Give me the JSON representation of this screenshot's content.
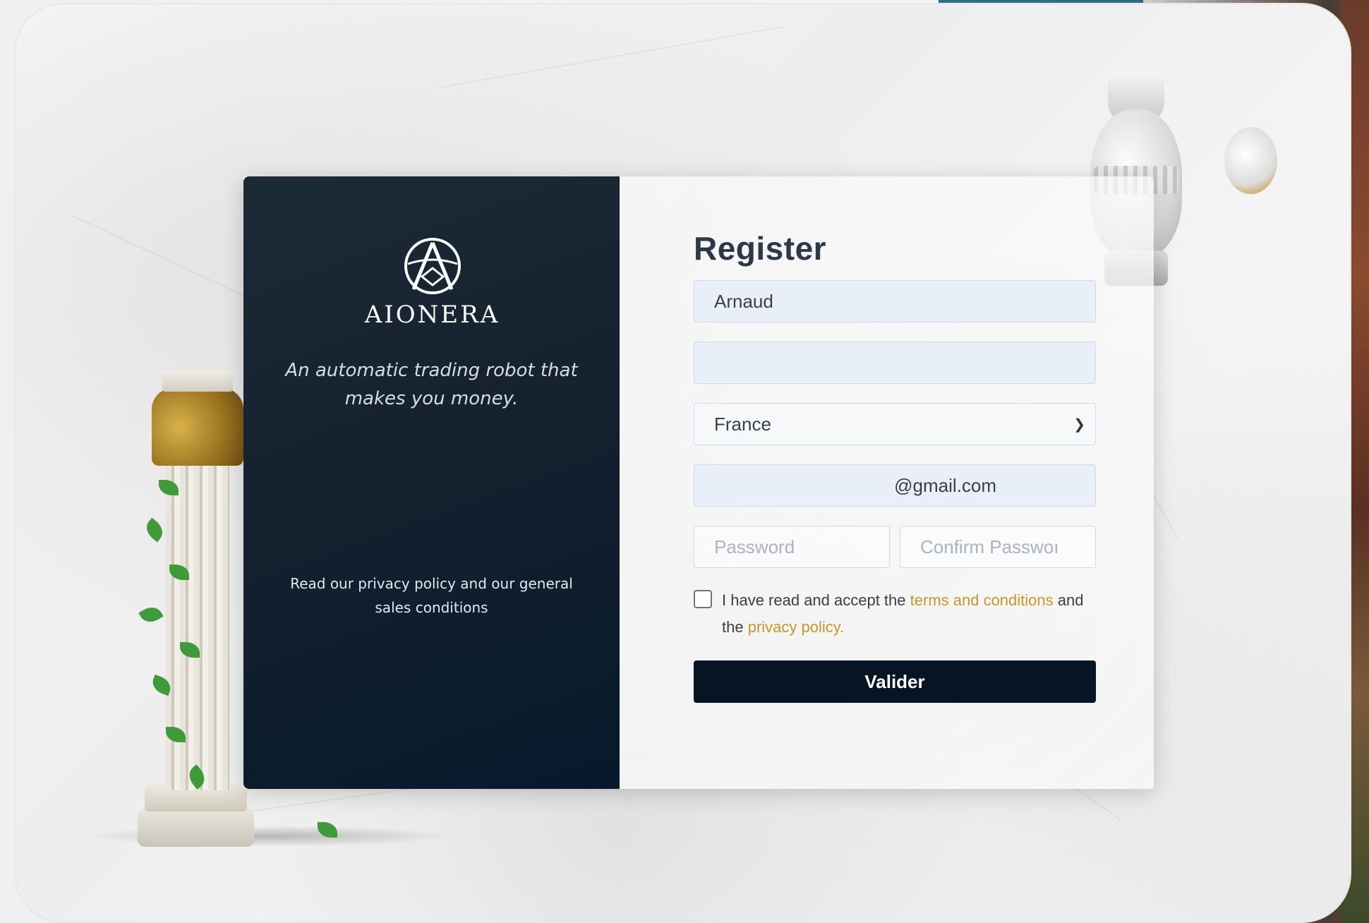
{
  "brand": {
    "name": "AIONERA",
    "tagline": "An automatic trading robot that makes you money.",
    "privacy_note": "Read our privacy policy and our general sales conditions"
  },
  "form": {
    "title": "Register",
    "first_name_value": "Arnaud",
    "last_name_value": "",
    "country_value": "France",
    "email_value": "@gmail.com",
    "password_placeholder": "Password",
    "confirm_password_placeholder": "Confirm Passwoı",
    "consent": {
      "prefix": "I have read and accept the ",
      "terms_link": "terms and conditions",
      "middle": " and the ",
      "privacy_link": "privacy policy."
    },
    "submit_label": "Valider"
  },
  "colors": {
    "panel_dark": "#14202e",
    "accent_gold": "#c8962a",
    "button_dark": "#061523",
    "field_bg": "#e8eff9"
  },
  "icons": [
    "aionera-logo",
    "chevron-down-icon"
  ]
}
